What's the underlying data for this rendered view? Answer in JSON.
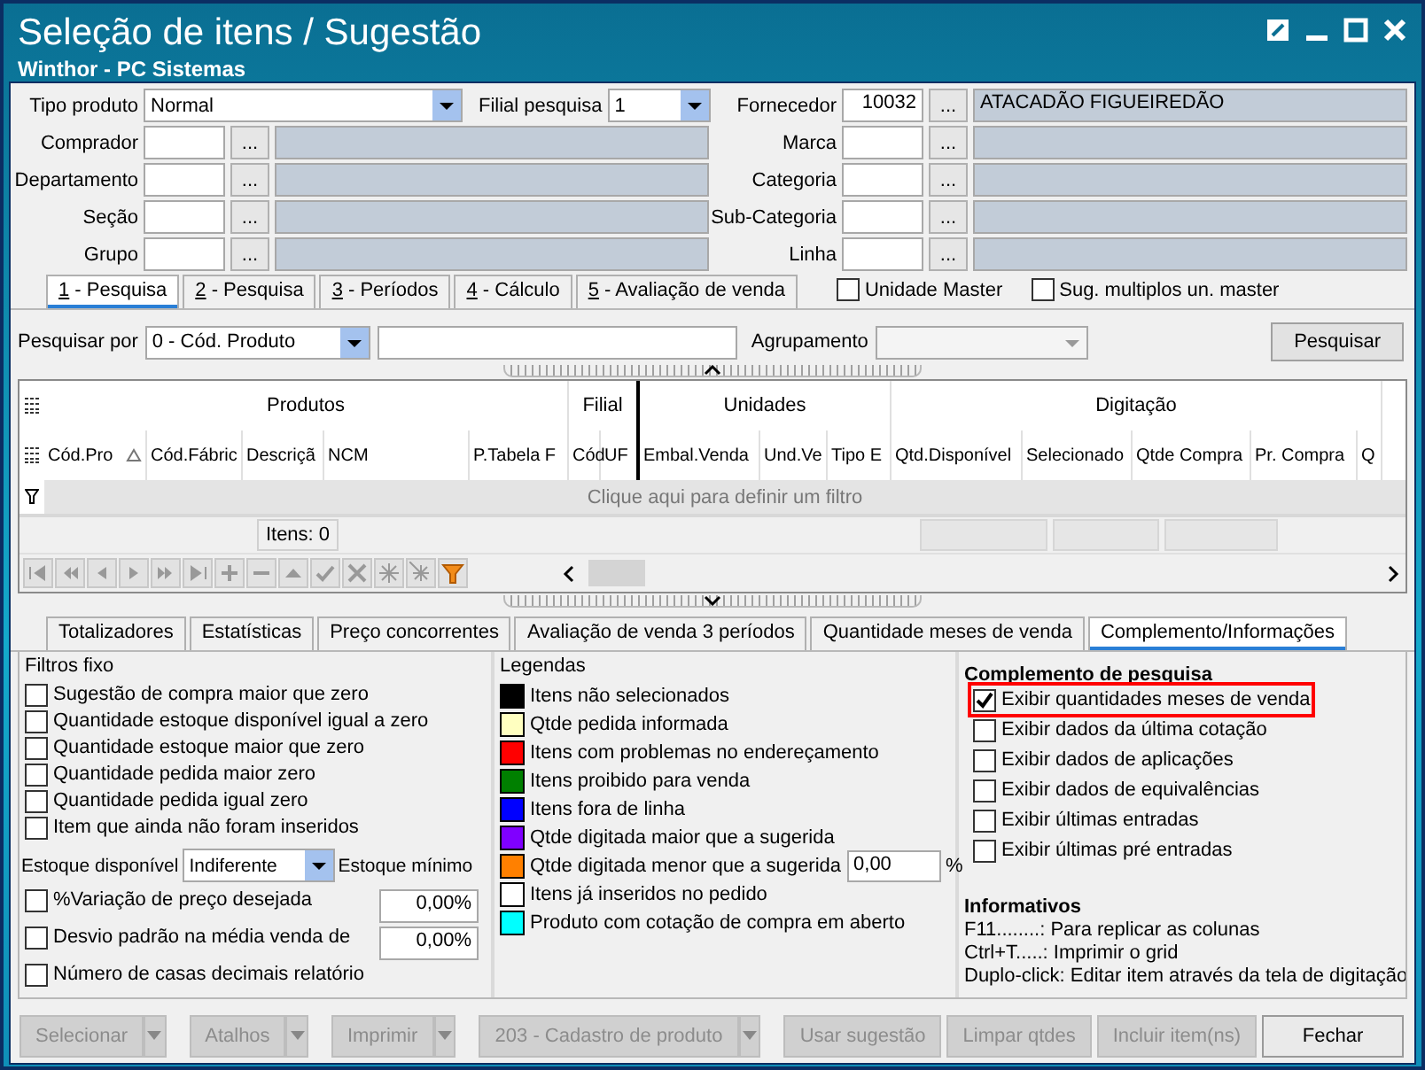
{
  "window": {
    "title": "Seleção de itens / Sugestão",
    "subtitle": "Winthor - PC Sistemas"
  },
  "tipo_produto": {
    "label": "Tipo produto",
    "value": "Normal"
  },
  "filial_pesquisa": {
    "label": "Filial pesquisa",
    "value": "1"
  },
  "lookups_left": [
    {
      "label": "Comprador",
      "button": "..."
    },
    {
      "label": "Departamento",
      "button": "..."
    },
    {
      "label": "Seção",
      "button": "..."
    },
    {
      "label": "Grupo",
      "button": "..."
    }
  ],
  "lookups_right": [
    {
      "label": "Fornecedor",
      "code": "10032",
      "button": "...",
      "description": "ATACADÃO FIGUEIREDÃO"
    },
    {
      "label": "Marca",
      "button": "..."
    },
    {
      "label": "Categoria",
      "button": "..."
    },
    {
      "label": "Sub-Categoria",
      "button": "..."
    },
    {
      "label": "Linha",
      "button": "..."
    }
  ],
  "tabs": [
    {
      "label": "1 - Pesquisa",
      "selected": true
    },
    {
      "label": "2 - Pesquisa",
      "selected": false
    },
    {
      "label": "3 - Períodos",
      "selected": false
    },
    {
      "label": "4 - Cálculo",
      "selected": false
    },
    {
      "label": "5 - Avaliação de venda",
      "selected": false
    }
  ],
  "options": [
    {
      "label": "Unidade Master",
      "checked": false
    },
    {
      "label": "Sug. multiplos un. master",
      "checked": false
    }
  ],
  "search": {
    "label": "Pesquisar por",
    "value": "0 - Cód. Produto",
    "grouping_label": "Agrupamento",
    "grouping_disabled": true,
    "button": "Pesquisar"
  },
  "grid": {
    "groups": [
      {
        "label": "Produtos",
        "columns": [
          {
            "label": "Cód.Pro",
            "sorted": true
          },
          {
            "label": "Cód.Fábric",
            "sorted": false
          },
          {
            "label": "Descriçã",
            "sorted": false
          },
          {
            "label": "NCM",
            "sorted": false
          },
          {
            "label": "P.Tabela F",
            "sorted": false
          }
        ]
      },
      {
        "label": "Filial",
        "columns": [
          {
            "label": "Cód",
            "sorted": false
          },
          {
            "label": "UF",
            "sorted": false
          }
        ]
      },
      {
        "label": "Unidades",
        "columns": [
          {
            "label": "Embal.Venda",
            "sorted": false
          },
          {
            "label": "Und.Ve",
            "sorted": false
          },
          {
            "label": "Tipo E",
            "sorted": false
          }
        ]
      },
      {
        "label": "Digitação",
        "columns": [
          {
            "label": "Qtd.Disponível",
            "sorted": false
          },
          {
            "label": "Selecionado",
            "sorted": false
          },
          {
            "label": "Qtde Compra",
            "sorted": false
          },
          {
            "label": "Pr. Compra",
            "sorted": false
          },
          {
            "label": "Q",
            "sorted": false
          }
        ]
      }
    ],
    "filter_prompt": "Clique aqui para definir um filtro",
    "items_count": "Itens: 0"
  },
  "bottom_tabs": [
    {
      "label": "Totalizadores",
      "selected": false
    },
    {
      "label": "Estatísticas",
      "selected": false
    },
    {
      "label": "Preço concorrentes",
      "selected": false
    },
    {
      "label": "Avaliação de venda 3 períodos",
      "selected": false
    },
    {
      "label": "Quantidade meses de venda",
      "selected": false
    },
    {
      "label": "Complemento/Informações",
      "selected": true
    }
  ],
  "filters": {
    "title": "Filtros fixo",
    "checks": [
      {
        "label": "Sugestão de compra maior que zero",
        "checked": false
      },
      {
        "label": "Quantidade estoque disponível igual a zero",
        "checked": false
      },
      {
        "label": "Quantidade estoque maior que zero",
        "checked": false
      },
      {
        "label": "Quantidade pedida maior zero",
        "checked": false
      },
      {
        "label": "Quantidade pedida igual zero",
        "checked": false
      },
      {
        "label": "Item que ainda não foram inseridos",
        "checked": false
      }
    ],
    "stock_label": "Estoque disponível",
    "stock_value": "Indiferente",
    "min_stock_label": "Estoque mínimo",
    "value_checks": [
      {
        "label": "%Variação de preço desejada",
        "checked": false,
        "value": "0,00%"
      },
      {
        "label": "Desvio padrão na média venda de",
        "checked": false,
        "value": "0,00%"
      },
      {
        "label": "Número de casas decimais relatório",
        "checked": false
      }
    ]
  },
  "legends": {
    "title": "Legendas",
    "items": [
      {
        "label": "Itens não selecionados",
        "color": "#000000"
      },
      {
        "label": "Qtde pedida informada",
        "color": "#ffffc0"
      },
      {
        "label": "Itens com problemas no endereçamento",
        "color": "#ff0000"
      },
      {
        "label": "Itens proibido para venda",
        "color": "#008000"
      },
      {
        "label": "Itens fora de linha",
        "color": "#0000ff"
      },
      {
        "label": "Qtde digitada maior que a sugerida",
        "color": "#8000ff"
      },
      {
        "label": "Qtde digitada menor que a sugerida",
        "color": "#ff8000",
        "value": "0,00",
        "unit": "%"
      },
      {
        "label": "Itens já inseridos no pedido",
        "color": "#ffffff"
      },
      {
        "label": "Produto com cotação de compra em aberto",
        "color": "#00ffff"
      }
    ]
  },
  "complement": {
    "title": "Complemento de pesquisa",
    "checks": [
      {
        "label": "Exibir quantidades meses de venda",
        "checked": true,
        "highlighted": true,
        "separated": false
      },
      {
        "label": "Exibir dados da última cotação",
        "checked": false,
        "highlighted": false,
        "separated": false
      },
      {
        "label": "Exibir dados de aplicações",
        "checked": false,
        "highlighted": false,
        "separated": false
      },
      {
        "label": "Exibir dados de equivalências",
        "checked": false,
        "highlighted": false,
        "separated": false
      },
      {
        "label": "Exibir últimas entradas",
        "checked": false,
        "highlighted": false,
        "separated": false
      },
      {
        "label": "Exibir últimas pré entradas",
        "checked": false,
        "highlighted": false,
        "separated": true
      }
    ],
    "info_title": "Informativos",
    "info": [
      "F11........: Para replicar as colunas",
      "Ctrl+T.....: Imprimir o grid",
      "Duplo-click: Editar item através da tela de digitação"
    ]
  },
  "buttons": [
    {
      "label": "Selecionar",
      "dropdown": true,
      "disabled": true
    },
    {
      "label": "Atalhos",
      "dropdown": true,
      "disabled": true
    },
    {
      "label": "Imprimir",
      "dropdown": true,
      "disabled": true
    },
    {
      "label": "203 - Cadastro de produto",
      "dropdown": true,
      "disabled": true
    },
    {
      "label": "Usar sugestão",
      "dropdown": false,
      "disabled": true
    },
    {
      "label": "Limpar qtdes",
      "dropdown": false,
      "disabled": true
    },
    {
      "label": "Incluir item(ns)",
      "dropdown": false,
      "disabled": true
    },
    {
      "label": "Fechar",
      "dropdown": false,
      "disabled": false
    }
  ]
}
